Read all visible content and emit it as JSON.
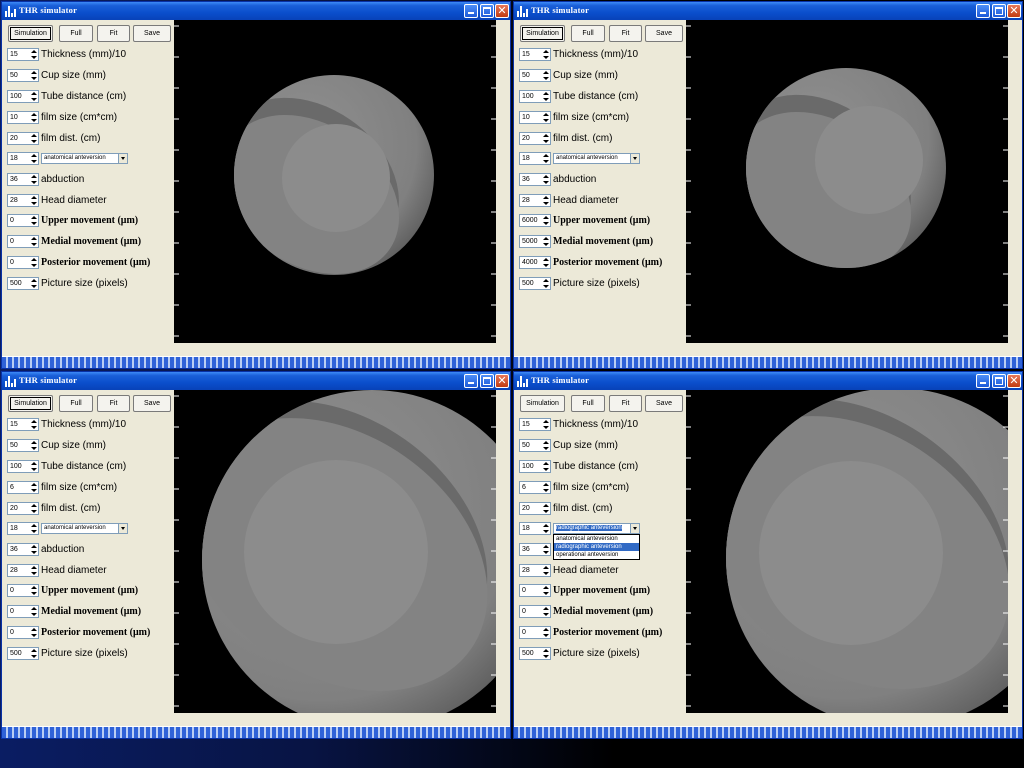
{
  "windows": [
    {
      "title": "THR simulator",
      "buttons": [
        "Simulation",
        "Full",
        "Fit",
        "Save"
      ],
      "selected_button": 0,
      "fields": [
        {
          "value": "15",
          "label": "Thickness (mm)/10"
        },
        {
          "value": "50",
          "label": "Cup size (mm)"
        },
        {
          "value": "100",
          "label": "Tube distance (cm)"
        },
        {
          "value": "10",
          "label": "film size (cm*cm)"
        },
        {
          "value": "20",
          "label": "film dist. (cm)"
        },
        {
          "value": "18",
          "combo": "anatomical anteversion"
        },
        {
          "value": "36",
          "label": "abduction"
        },
        {
          "value": "28",
          "label": "Head diameter"
        },
        {
          "value": "0",
          "label": "Upper movement (μm)",
          "mono": true
        },
        {
          "value": "0",
          "label": "Medial movement (μm)",
          "mono": true
        },
        {
          "value": "0",
          "label": "Posterior movement (μm)",
          "mono": true
        },
        {
          "value": "500",
          "label": "Picture size (pixels)"
        }
      ]
    },
    {
      "title": "THR simulator",
      "buttons": [
        "Simulation",
        "Full",
        "Fit",
        "Save"
      ],
      "selected_button": 0,
      "fields": [
        {
          "value": "15",
          "label": "Thickness (mm)/10"
        },
        {
          "value": "50",
          "label": "Cup size (mm)"
        },
        {
          "value": "100",
          "label": "Tube distance (cm)"
        },
        {
          "value": "10",
          "label": "film size (cm*cm)"
        },
        {
          "value": "20",
          "label": "film dist. (cm)"
        },
        {
          "value": "18",
          "combo": "anatomical anteversion"
        },
        {
          "value": "36",
          "label": "abduction"
        },
        {
          "value": "28",
          "label": "Head diameter"
        },
        {
          "value": "6000",
          "label": "Upper movement (μm)",
          "mono": true
        },
        {
          "value": "5000",
          "label": "Medial movement (μm)",
          "mono": true
        },
        {
          "value": "4000",
          "label": "Posterior movement (μm)",
          "mono": true
        },
        {
          "value": "500",
          "label": "Picture size (pixels)"
        }
      ]
    },
    {
      "title": "THR simulator",
      "buttons": [
        "Simulation",
        "Full",
        "Fit",
        "Save"
      ],
      "selected_button": 0,
      "fields": [
        {
          "value": "15",
          "label": "Thickness (mm)/10"
        },
        {
          "value": "50",
          "label": "Cup size (mm)"
        },
        {
          "value": "100",
          "label": "Tube distance (cm)"
        },
        {
          "value": "6",
          "label": "film size (cm*cm)"
        },
        {
          "value": "20",
          "label": "film dist. (cm)"
        },
        {
          "value": "18",
          "combo": "anatomical anteversion"
        },
        {
          "value": "36",
          "label": "abduction"
        },
        {
          "value": "28",
          "label": "Head diameter"
        },
        {
          "value": "0",
          "label": "Upper movement (μm)",
          "mono": true
        },
        {
          "value": "0",
          "label": "Medial movement (μm)",
          "mono": true
        },
        {
          "value": "0",
          "label": "Posterior movement (μm)",
          "mono": true
        },
        {
          "value": "500",
          "label": "Picture size (pixels)"
        }
      ]
    },
    {
      "title": "THR simulator",
      "buttons": [
        "Simulation",
        "Full",
        "Fit",
        "Save"
      ],
      "selected_button": -1,
      "fields": [
        {
          "value": "15",
          "label": "Thickness (mm)/10"
        },
        {
          "value": "50",
          "label": "Cup size (mm)"
        },
        {
          "value": "100",
          "label": "Tube distance (cm)"
        },
        {
          "value": "6",
          "label": "film size (cm*cm)"
        },
        {
          "value": "20",
          "label": "film dist. (cm)"
        },
        {
          "value": "18",
          "combo": "radiographic anteversion",
          "combo_focus": true,
          "options": [
            "anatomical anteversion",
            "radiographic anteversion",
            "operational anteversion"
          ],
          "highlighted": 1
        },
        {
          "value": "36",
          "label": "abduction"
        },
        {
          "value": "28",
          "label": "Head diameter"
        },
        {
          "value": "0",
          "label": "Upper movement (μm)",
          "mono": true
        },
        {
          "value": "0",
          "label": "Medial movement (μm)",
          "mono": true
        },
        {
          "value": "0",
          "label": "Posterior movement (μm)",
          "mono": true
        },
        {
          "value": "500",
          "label": "Picture size (pixels)"
        }
      ]
    }
  ],
  "icons": {
    "app": "app-icon",
    "minimize": "minimize-icon",
    "maximize": "maximize-icon",
    "close": "close-icon"
  },
  "colors": {
    "titlebar": "#0a4ecc",
    "face": "#ece9d8",
    "viewer_bg": "#000000",
    "cup": "#808080",
    "head": "#8c8c8c",
    "selection": "#316ac5"
  }
}
